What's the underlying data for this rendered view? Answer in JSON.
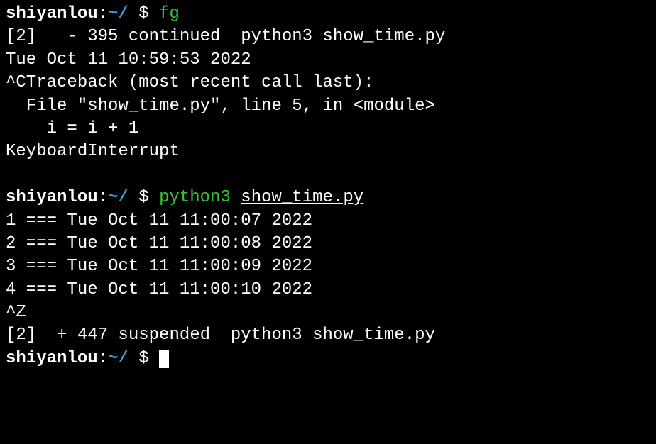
{
  "prompt": {
    "user": "shiyanlou",
    "path": "~/",
    "symbol": "$"
  },
  "block1": {
    "command": "fg",
    "job_line": "[2]   - 395 continued  python3 show_time.py",
    "timestamp": "Tue Oct 11 10:59:53 2022",
    "traceback_head": "^CTraceback (most recent call last):",
    "traceback_file": "  File \"show_time.py\", line 5, in <module>",
    "traceback_code": "    i = i + 1",
    "traceback_err": "KeyboardInterrupt"
  },
  "block2": {
    "command": "python3",
    "arg": "show_time.py",
    "out1": "1 === Tue Oct 11 11:00:07 2022",
    "out2": "2 === Tue Oct 11 11:00:08 2022",
    "out3": "3 === Tue Oct 11 11:00:09 2022",
    "out4": "4 === Tue Oct 11 11:00:10 2022",
    "suspend_sig": "^Z",
    "suspend_msg": "[2]  + 447 suspended  python3 show_time.py"
  }
}
